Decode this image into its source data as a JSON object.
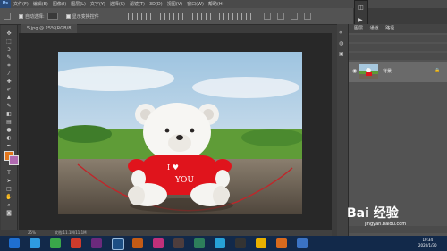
{
  "app": {
    "logo": "Ps"
  },
  "menu": [
    "文件(F)",
    "编辑(E)",
    "图像(I)",
    "图层(L)",
    "文字(Y)",
    "选择(S)",
    "滤镜(T)",
    "3D(D)",
    "视图(V)",
    "窗口(W)",
    "帮助(H)"
  ],
  "options": {
    "auto_select": "自动选择:",
    "show_transform": "显示变换控件"
  },
  "document": {
    "tab_title": "5.jpg @ 25%(RGB/8)",
    "zoom": "25%",
    "doc_size": "文档:11.1M/11.1M"
  },
  "layers_panel": {
    "tabs": [
      "图层",
      "通道",
      "路径"
    ],
    "layer_name": "背景"
  },
  "photo": {
    "shirt_text_1": "I ♥",
    "shirt_text_2": "YOU"
  },
  "taskbar": {
    "time": "10:34",
    "date": "2020/1/30"
  },
  "watermark": {
    "brand": "Bai 经验",
    "url": "jingyan.baidu.com"
  },
  "colors": {
    "foreground": "#e2761c",
    "background": "#b06ab0"
  }
}
